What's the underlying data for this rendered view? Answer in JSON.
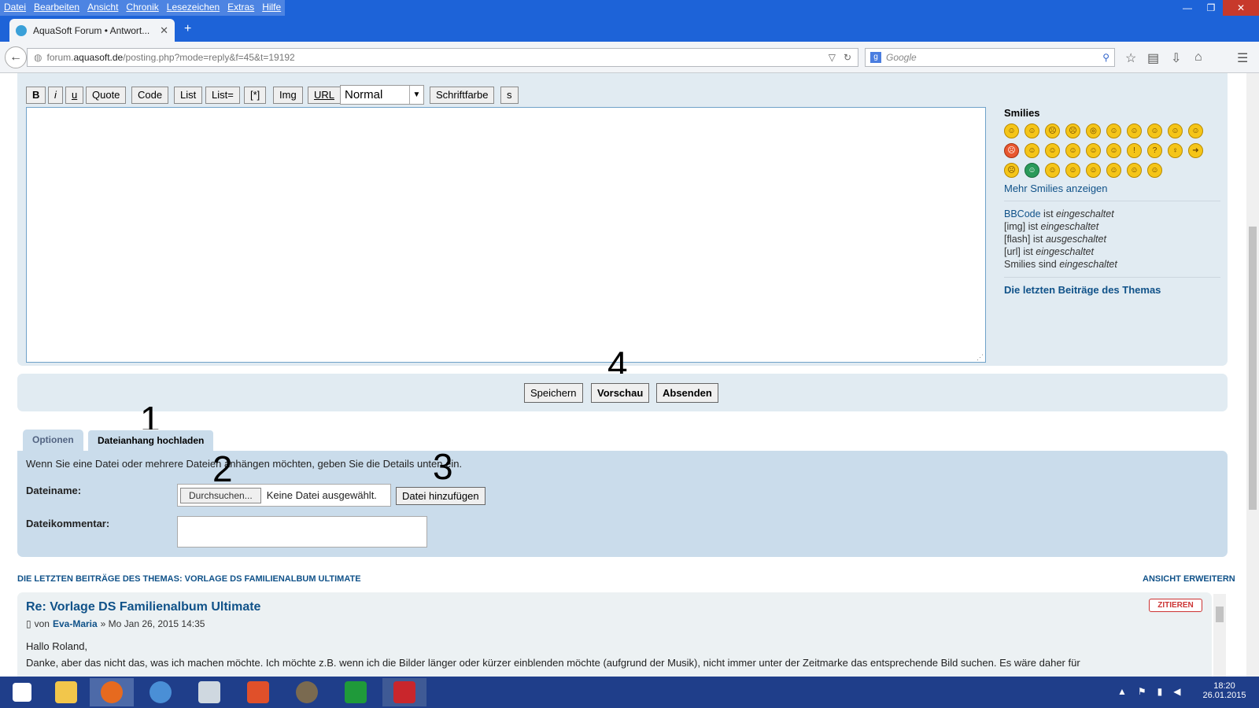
{
  "menu": {
    "items": [
      "Datei",
      "Bearbeiten",
      "Ansicht",
      "Chronik",
      "Lesezeichen",
      "Extras",
      "Hilfe"
    ]
  },
  "window": {
    "minimize": "—",
    "restore": "❐",
    "close": "✕"
  },
  "tab": {
    "title": "AquaSoft Forum • Antwort...",
    "close": "✕",
    "new_tab": "+"
  },
  "nav": {
    "url_prefix": "forum.",
    "url_host": "aquasoft.de",
    "url_path": "/posting.php?mode=reply&f=45&t=19192",
    "search_placeholder": "Google"
  },
  "editor": {
    "toolbar": [
      "B",
      "i",
      "u",
      "Quote",
      "Code",
      "List",
      "List=",
      "[*]",
      "Img",
      "URL"
    ],
    "font_size": "Normal",
    "font_color": "Schriftfarbe",
    "s": "s"
  },
  "smilies": {
    "heading": "Smilies",
    "more": "Mehr Smilies anzeigen",
    "status": [
      {
        "label": "BBCode",
        "mid": " ist ",
        "state": "eingeschaltet"
      },
      {
        "label": "[img]",
        "mid": " ist ",
        "state": "eingeschaltet"
      },
      {
        "label": "[flash]",
        "mid": " ist ",
        "state": "ausgeschaltet"
      },
      {
        "label": "[url]",
        "mid": " ist ",
        "state": "eingeschaltet"
      },
      {
        "label": "Smilies",
        "mid": " sind ",
        "state": "eingeschaltet"
      }
    ],
    "recent_link": "Die letzten Beiträge des Themas"
  },
  "actions": {
    "save": "Speichern",
    "preview": "Vorschau",
    "submit": "Absenden"
  },
  "annotations": {
    "n1": "1",
    "n2": "2",
    "n3": "3",
    "n4": "4"
  },
  "tabs": {
    "options": "Optionen",
    "upload": "Dateianhang hochladen"
  },
  "attachment": {
    "intro": "Wenn Sie eine Datei oder mehrere Dateien anhängen möchten, geben Sie die Details unten ein.",
    "filename_label": "Dateiname:",
    "browse": "Durchsuchen...",
    "no_file": "Keine Datei ausgewählt.",
    "add_file": "Datei hinzufügen",
    "comment_label": "Dateikommentar:"
  },
  "recent": {
    "heading": "DIE LETZTEN BEITRÄGE DES THEMAS: VORLAGE DS FAMILIENALBUM ULTIMATE",
    "expand": "ANSICHT ERWEITERN",
    "post_title": "Re: Vorlage DS Familienalbum Ultimate",
    "by": "von",
    "author": "Eva-Maria",
    "date": "» Mo Jan 26, 2015 14:35",
    "quote": "ZITIEREN",
    "greeting": "Hallo Roland,",
    "body": "Danke, aber das nicht das, was ich machen möchte. Ich möchte z.B. wenn ich die Bilder länger oder kürzer einblenden möchte (aufgrund der Musik), nicht immer unter der Zeitmarke das entsprechende Bild suchen. Es wäre daher für"
  },
  "clock": {
    "time": "18:20",
    "date": "26.01.2015"
  }
}
